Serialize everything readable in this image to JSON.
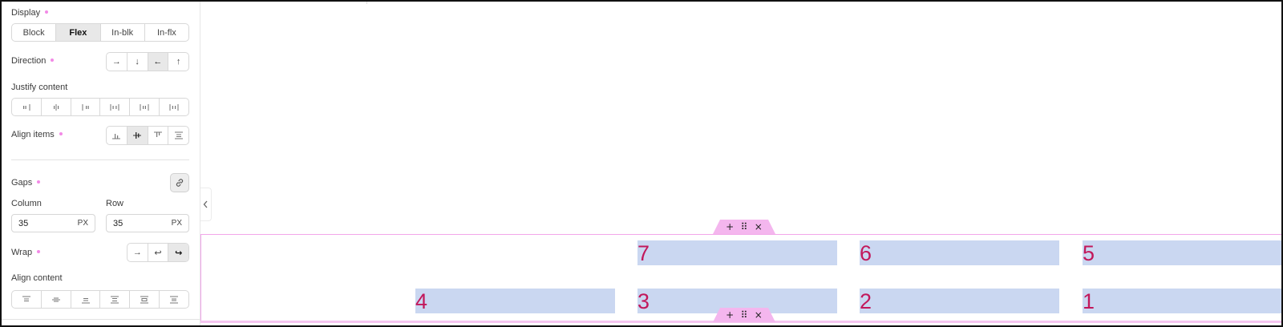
{
  "sidebar": {
    "display": {
      "label": "Display",
      "options": [
        "Block",
        "Flex",
        "In-blk",
        "In-flx"
      ],
      "selected": "Flex"
    },
    "direction": {
      "label": "Direction",
      "options": [
        "→",
        "↓",
        "←",
        "↑"
      ],
      "selected": "←"
    },
    "justify_content": {
      "label": "Justify content",
      "options": [
        "justify-start-icon",
        "justify-center-icon",
        "justify-end-icon",
        "justify-space-between-icon",
        "justify-space-around-icon",
        "justify-space-evenly-icon"
      ]
    },
    "align_items": {
      "label": "Align items",
      "options": [
        "align-end-icon",
        "align-center-icon",
        "align-start-icon",
        "align-stretch-icon"
      ],
      "selected": "align-center-icon"
    },
    "gaps": {
      "label": "Gaps",
      "link_icon": "link-icon",
      "column": {
        "label": "Column",
        "value": "35",
        "unit": "PX"
      },
      "row": {
        "label": "Row",
        "value": "35",
        "unit": "PX"
      }
    },
    "wrap": {
      "label": "Wrap",
      "options": [
        "→",
        "↩",
        "↪"
      ],
      "selected": "↪"
    },
    "align_content": {
      "label": "Align content",
      "options": [
        "align-content-start-icon",
        "align-content-center-icon",
        "align-content-end-icon",
        "align-content-space-between-icon",
        "align-content-space-around-icon",
        "align-content-stretch-icon"
      ]
    }
  },
  "canvas": {
    "toolbar": {
      "add": "+",
      "drag": "⠿",
      "close": "×"
    },
    "items_row1": [
      "7",
      "6",
      "5"
    ],
    "items_row2": [
      "4",
      "3",
      "2",
      "1"
    ]
  },
  "colors": {
    "accent": "#f28ae6",
    "item_bg": "#cad7f1",
    "item_text": "#c2185b",
    "outline": "#f2a6ea"
  }
}
